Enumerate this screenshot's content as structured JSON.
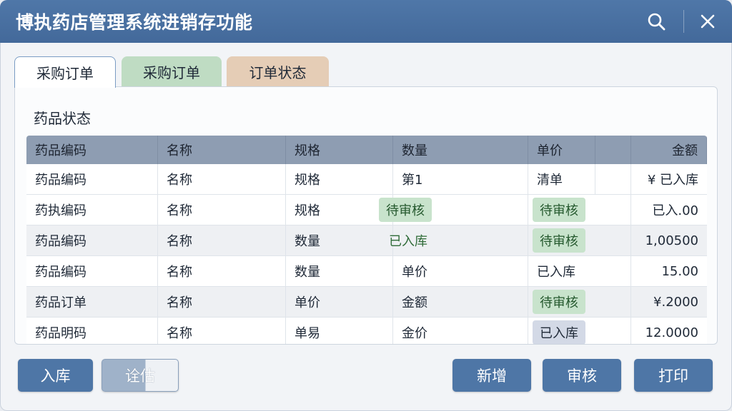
{
  "window": {
    "title": "博执药店管理系统进销存功能"
  },
  "titlebar_icons": {
    "search": "search-icon",
    "close": "close-icon"
  },
  "tabs": [
    {
      "label": "采购订单",
      "state": "active"
    },
    {
      "label": "采购订单",
      "color": "#bfdcc3"
    },
    {
      "label": "订单状态",
      "color": "#e5cdb6"
    }
  ],
  "panel": {
    "section_title": "药品状态"
  },
  "table": {
    "headers": [
      "药品编码",
      "名称",
      "规格",
      "数量",
      "单价",
      "金额"
    ],
    "rows": [
      {
        "code": "药品编码",
        "name": "名称",
        "spec": "规格",
        "qty": "第1",
        "price": "清单",
        "amount": "¥ 已入库"
      },
      {
        "code": "药执编码",
        "name": "名称",
        "spec": "规格",
        "qty": "待审核",
        "qty_badge": "green",
        "price": "待审核",
        "price_badge": "green",
        "amount": "已入.00"
      },
      {
        "code": "药品编码",
        "name": "名称",
        "spec": "数量",
        "qty": "已入库",
        "qty_badge": "text-green",
        "price": "待审核",
        "price_badge": "green",
        "amount": "1,00500"
      },
      {
        "code": "药品编码",
        "name": "名称",
        "spec": "数量",
        "qty": "单价",
        "price": "已入库",
        "amount": "15.00"
      },
      {
        "code": "药品订单",
        "name": "名称",
        "spec": "单价",
        "qty": "金额",
        "price": "待审核",
        "price_badge": "green",
        "amount": "¥.2000"
      },
      {
        "code": "药品明码",
        "name": "名称",
        "spec": "单易",
        "qty": "金价",
        "price": "已入库",
        "price_badge": "gray",
        "amount": "12.0000"
      }
    ]
  },
  "buttons": {
    "stock_in": "入库",
    "secondary": "诠估",
    "add": "新增",
    "audit": "审核",
    "print": "打印"
  },
  "colors": {
    "titlebar": "#4a70a1",
    "button": "#4e76a6",
    "badge_green": "#c8e3cc",
    "badge_gray": "#d3d9e6",
    "header_row": "#8e9db2"
  }
}
